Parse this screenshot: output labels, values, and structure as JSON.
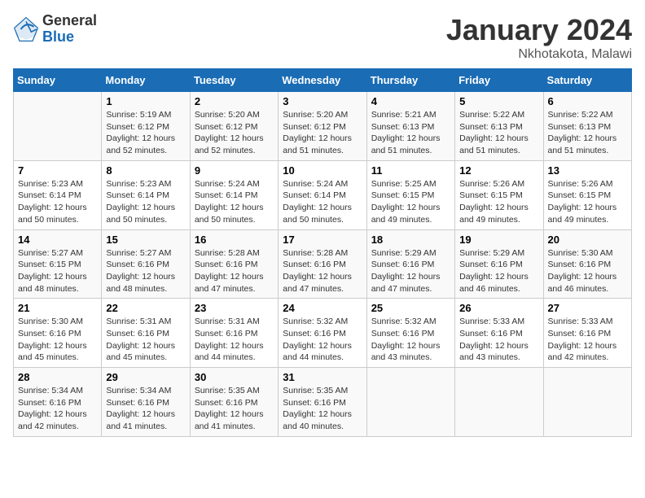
{
  "header": {
    "logo_general": "General",
    "logo_blue": "Blue",
    "title": "January 2024",
    "subtitle": "Nkhotakota, Malawi"
  },
  "columns": [
    "Sunday",
    "Monday",
    "Tuesday",
    "Wednesday",
    "Thursday",
    "Friday",
    "Saturday"
  ],
  "weeks": [
    [
      {
        "day": "",
        "info": ""
      },
      {
        "day": "1",
        "info": "Sunrise: 5:19 AM\nSunset: 6:12 PM\nDaylight: 12 hours\nand 52 minutes."
      },
      {
        "day": "2",
        "info": "Sunrise: 5:20 AM\nSunset: 6:12 PM\nDaylight: 12 hours\nand 52 minutes."
      },
      {
        "day": "3",
        "info": "Sunrise: 5:20 AM\nSunset: 6:12 PM\nDaylight: 12 hours\nand 51 minutes."
      },
      {
        "day": "4",
        "info": "Sunrise: 5:21 AM\nSunset: 6:13 PM\nDaylight: 12 hours\nand 51 minutes."
      },
      {
        "day": "5",
        "info": "Sunrise: 5:22 AM\nSunset: 6:13 PM\nDaylight: 12 hours\nand 51 minutes."
      },
      {
        "day": "6",
        "info": "Sunrise: 5:22 AM\nSunset: 6:13 PM\nDaylight: 12 hours\nand 51 minutes."
      }
    ],
    [
      {
        "day": "7",
        "info": "Sunrise: 5:23 AM\nSunset: 6:14 PM\nDaylight: 12 hours\nand 50 minutes."
      },
      {
        "day": "8",
        "info": "Sunrise: 5:23 AM\nSunset: 6:14 PM\nDaylight: 12 hours\nand 50 minutes."
      },
      {
        "day": "9",
        "info": "Sunrise: 5:24 AM\nSunset: 6:14 PM\nDaylight: 12 hours\nand 50 minutes."
      },
      {
        "day": "10",
        "info": "Sunrise: 5:24 AM\nSunset: 6:14 PM\nDaylight: 12 hours\nand 50 minutes."
      },
      {
        "day": "11",
        "info": "Sunrise: 5:25 AM\nSunset: 6:15 PM\nDaylight: 12 hours\nand 49 minutes."
      },
      {
        "day": "12",
        "info": "Sunrise: 5:26 AM\nSunset: 6:15 PM\nDaylight: 12 hours\nand 49 minutes."
      },
      {
        "day": "13",
        "info": "Sunrise: 5:26 AM\nSunset: 6:15 PM\nDaylight: 12 hours\nand 49 minutes."
      }
    ],
    [
      {
        "day": "14",
        "info": "Sunrise: 5:27 AM\nSunset: 6:15 PM\nDaylight: 12 hours\nand 48 minutes."
      },
      {
        "day": "15",
        "info": "Sunrise: 5:27 AM\nSunset: 6:16 PM\nDaylight: 12 hours\nand 48 minutes."
      },
      {
        "day": "16",
        "info": "Sunrise: 5:28 AM\nSunset: 6:16 PM\nDaylight: 12 hours\nand 47 minutes."
      },
      {
        "day": "17",
        "info": "Sunrise: 5:28 AM\nSunset: 6:16 PM\nDaylight: 12 hours\nand 47 minutes."
      },
      {
        "day": "18",
        "info": "Sunrise: 5:29 AM\nSunset: 6:16 PM\nDaylight: 12 hours\nand 47 minutes."
      },
      {
        "day": "19",
        "info": "Sunrise: 5:29 AM\nSunset: 6:16 PM\nDaylight: 12 hours\nand 46 minutes."
      },
      {
        "day": "20",
        "info": "Sunrise: 5:30 AM\nSunset: 6:16 PM\nDaylight: 12 hours\nand 46 minutes."
      }
    ],
    [
      {
        "day": "21",
        "info": "Sunrise: 5:30 AM\nSunset: 6:16 PM\nDaylight: 12 hours\nand 45 minutes."
      },
      {
        "day": "22",
        "info": "Sunrise: 5:31 AM\nSunset: 6:16 PM\nDaylight: 12 hours\nand 45 minutes."
      },
      {
        "day": "23",
        "info": "Sunrise: 5:31 AM\nSunset: 6:16 PM\nDaylight: 12 hours\nand 44 minutes."
      },
      {
        "day": "24",
        "info": "Sunrise: 5:32 AM\nSunset: 6:16 PM\nDaylight: 12 hours\nand 44 minutes."
      },
      {
        "day": "25",
        "info": "Sunrise: 5:32 AM\nSunset: 6:16 PM\nDaylight: 12 hours\nand 43 minutes."
      },
      {
        "day": "26",
        "info": "Sunrise: 5:33 AM\nSunset: 6:16 PM\nDaylight: 12 hours\nand 43 minutes."
      },
      {
        "day": "27",
        "info": "Sunrise: 5:33 AM\nSunset: 6:16 PM\nDaylight: 12 hours\nand 42 minutes."
      }
    ],
    [
      {
        "day": "28",
        "info": "Sunrise: 5:34 AM\nSunset: 6:16 PM\nDaylight: 12 hours\nand 42 minutes."
      },
      {
        "day": "29",
        "info": "Sunrise: 5:34 AM\nSunset: 6:16 PM\nDaylight: 12 hours\nand 41 minutes."
      },
      {
        "day": "30",
        "info": "Sunrise: 5:35 AM\nSunset: 6:16 PM\nDaylight: 12 hours\nand 41 minutes."
      },
      {
        "day": "31",
        "info": "Sunrise: 5:35 AM\nSunset: 6:16 PM\nDaylight: 12 hours\nand 40 minutes."
      },
      {
        "day": "",
        "info": ""
      },
      {
        "day": "",
        "info": ""
      },
      {
        "day": "",
        "info": ""
      }
    ]
  ]
}
